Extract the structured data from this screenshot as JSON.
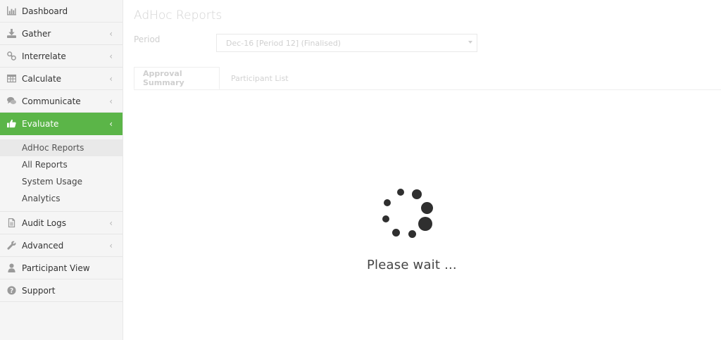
{
  "sidebar": {
    "items": [
      {
        "label": "Dashboard",
        "icon": "bar-chart-icon",
        "has_chevron": false
      },
      {
        "label": "Gather",
        "icon": "download-icon",
        "has_chevron": true
      },
      {
        "label": "Interrelate",
        "icon": "link-icon",
        "has_chevron": true
      },
      {
        "label": "Calculate",
        "icon": "table-icon",
        "has_chevron": true
      },
      {
        "label": "Communicate",
        "icon": "comments-icon",
        "has_chevron": true
      },
      {
        "label": "Evaluate",
        "icon": "thumbs-up-icon",
        "has_chevron": true,
        "active": true
      }
    ],
    "sub_items": [
      "AdHoc Reports",
      "All Reports",
      "System Usage",
      "Analytics"
    ],
    "items_after": [
      {
        "label": "Audit Logs",
        "icon": "document-icon",
        "has_chevron": true
      },
      {
        "label": "Advanced",
        "icon": "wrench-icon",
        "has_chevron": true
      },
      {
        "label": "Participant View",
        "icon": "user-icon",
        "has_chevron": false
      },
      {
        "label": "Support",
        "icon": "question-circle-icon",
        "has_chevron": false
      }
    ],
    "chevron_glyph": "‹"
  },
  "main": {
    "title": "AdHoc Reports",
    "period_label": "Period",
    "period_value": "Dec-16 [Period 12] (Finalised)",
    "tabs": [
      {
        "label": "Approval Summary",
        "active": true
      },
      {
        "label": "Participant List",
        "active": false
      }
    ]
  },
  "loader": {
    "text": "Please wait ..."
  },
  "colors": {
    "active_green": "#5bb548",
    "sidebar_bg": "#f5f5f5",
    "spinner_dot": "#2f2f2f"
  }
}
